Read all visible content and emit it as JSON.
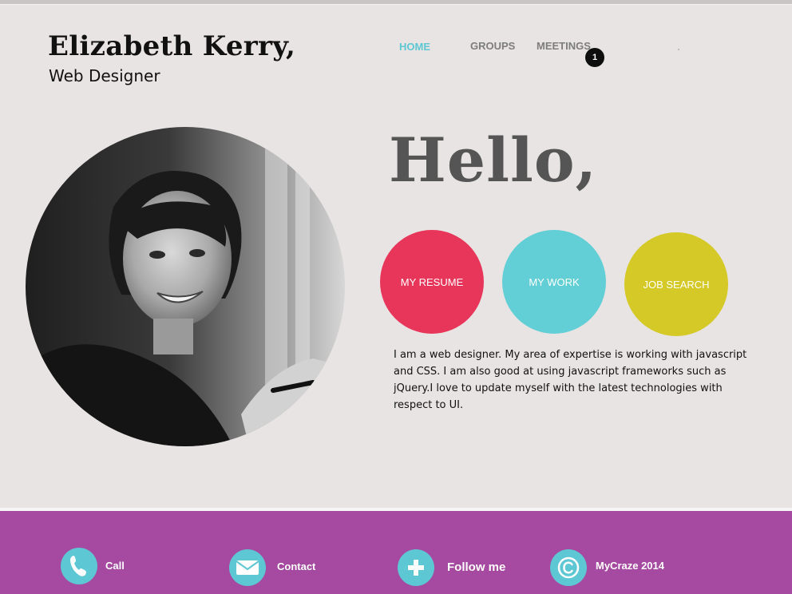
{
  "header": {
    "name": "Elizabeth Kerry,",
    "role": "Web Designer"
  },
  "nav": {
    "items": [
      {
        "label": "HOME",
        "active": true
      },
      {
        "label": "GROUPS",
        "active": false
      },
      {
        "label": "MEETINGS",
        "active": false
      }
    ],
    "meetings_badge": "1"
  },
  "hero": {
    "greeting": "Hello,",
    "buttons": [
      {
        "label": "MY RESUME",
        "color": "#e8365a"
      },
      {
        "label": "MY WORK",
        "color": "#62cfd6"
      },
      {
        "label": "JOB SEARCH",
        "color": "#d4c926"
      }
    ],
    "bio": "I am a web designer. My area of expertise is working with javascript and CSS. I am also good at using javascript frameworks such as jQuery.I love to update myself with the latest technologies with respect to UI."
  },
  "footer": {
    "background": "#a54aa0",
    "icon_color": "#5dc7d3",
    "items": [
      {
        "icon": "phone-icon",
        "label": "Call"
      },
      {
        "icon": "mail-icon",
        "label": "Contact"
      },
      {
        "icon": "plus-icon",
        "label": "Follow me"
      },
      {
        "icon": "copyright-icon",
        "label": "MyCraze 2014"
      }
    ]
  },
  "colors": {
    "page_background": "#e8e4e3",
    "nav_active": "#5dc7d3",
    "nav_inactive": "#7d7d7d"
  }
}
